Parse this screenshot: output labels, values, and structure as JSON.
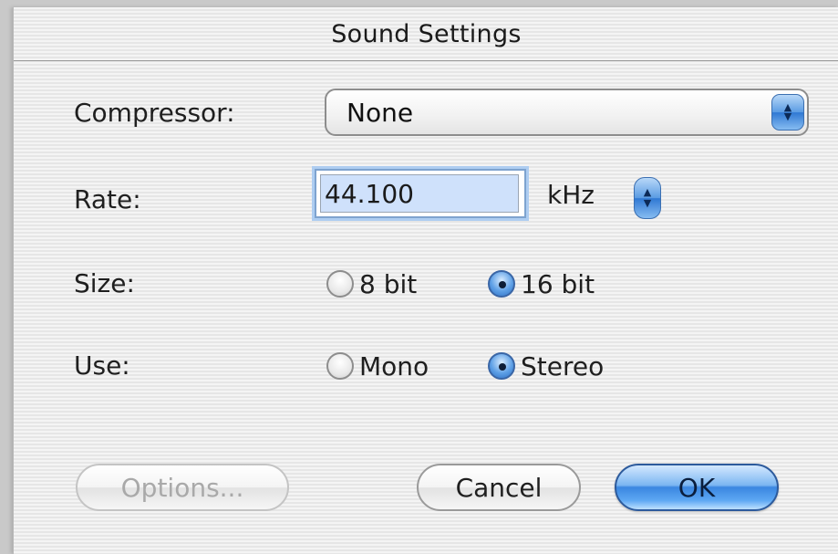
{
  "window": {
    "title": "Sound Settings"
  },
  "compressor": {
    "label": "Compressor:",
    "value": "None"
  },
  "rate": {
    "label": "Rate:",
    "value": "44.100",
    "unit": "kHz"
  },
  "size": {
    "label": "Size:",
    "options": [
      {
        "label": "8 bit",
        "selected": false
      },
      {
        "label": "16 bit",
        "selected": true
      }
    ]
  },
  "use": {
    "label": "Use:",
    "options": [
      {
        "label": "Mono",
        "selected": false
      },
      {
        "label": "Stereo",
        "selected": true
      }
    ]
  },
  "buttons": {
    "options": "Options...",
    "cancel": "Cancel",
    "ok": "OK"
  },
  "colors": {
    "accent": "#3a86e0",
    "disabled_text": "#a9a9a9"
  }
}
